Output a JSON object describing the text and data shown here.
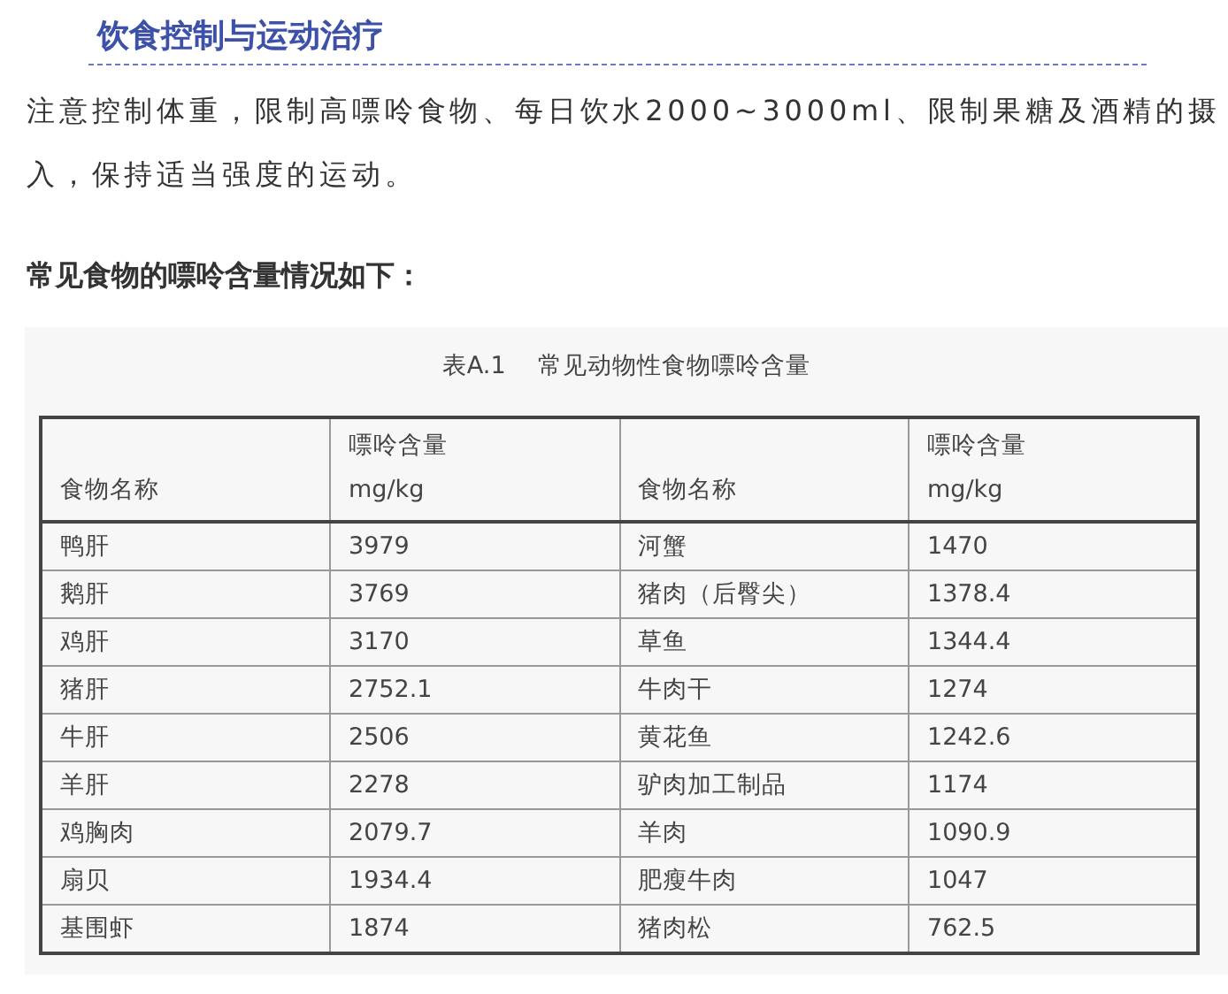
{
  "section_title": "饮食控制与运动治疗",
  "paragraph": "注意控制体重，限制高嘌呤食物、每日饮水2000~3000ml、限制果糖及酒精的摄入，保持适当强度的运动。",
  "subheading": "常见食物的嘌呤含量情况如下：",
  "table": {
    "caption": "表A.1　 常见动物性食物嘌呤含量",
    "columns": [
      {
        "label": "食物名称"
      },
      {
        "label": "嘌呤含量",
        "unit": "mg/kg"
      },
      {
        "label": "食物名称"
      },
      {
        "label": "嘌呤含量",
        "unit": "mg/kg"
      }
    ],
    "rows": [
      [
        "鸭肝",
        "3979",
        "河蟹",
        "1470"
      ],
      [
        "鹅肝",
        "3769",
        "猪肉（后臀尖）",
        "1378.4"
      ],
      [
        "鸡肝",
        "3170",
        "草鱼",
        "1344.4"
      ],
      [
        "猪肝",
        "2752.1",
        "牛肉干",
        "1274"
      ],
      [
        "牛肝",
        "2506",
        "黄花鱼",
        "1242.6"
      ],
      [
        "羊肝",
        "2278",
        "驴肉加工制品",
        "1174"
      ],
      [
        "鸡胸肉",
        "2079.7",
        "羊肉",
        "1090.9"
      ],
      [
        "扇贝",
        "1934.4",
        "肥瘦牛肉",
        "1047"
      ],
      [
        "基围虾",
        "1874",
        "猪肉松",
        "762.5"
      ]
    ]
  }
}
